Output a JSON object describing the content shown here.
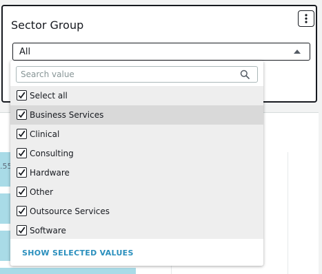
{
  "filter": {
    "title": "Sector Group",
    "selected_value": "All"
  },
  "search": {
    "placeholder": "Search value"
  },
  "options": [
    {
      "label": "Select all",
      "checked": true
    },
    {
      "label": "Business Services",
      "checked": true
    },
    {
      "label": "Clinical",
      "checked": true
    },
    {
      "label": "Consulting",
      "checked": true
    },
    {
      "label": "Hardware",
      "checked": true
    },
    {
      "label": "Other",
      "checked": true
    },
    {
      "label": "Outsource Services",
      "checked": true
    },
    {
      "label": "Software",
      "checked": true
    }
  ],
  "footer": {
    "show_selected_label": "SHOW SELECTED VALUES"
  },
  "background_visual": {
    "partial_number": ".55"
  },
  "colors": {
    "accent": "#2a8fbd",
    "bar": "#a9dbe7"
  }
}
